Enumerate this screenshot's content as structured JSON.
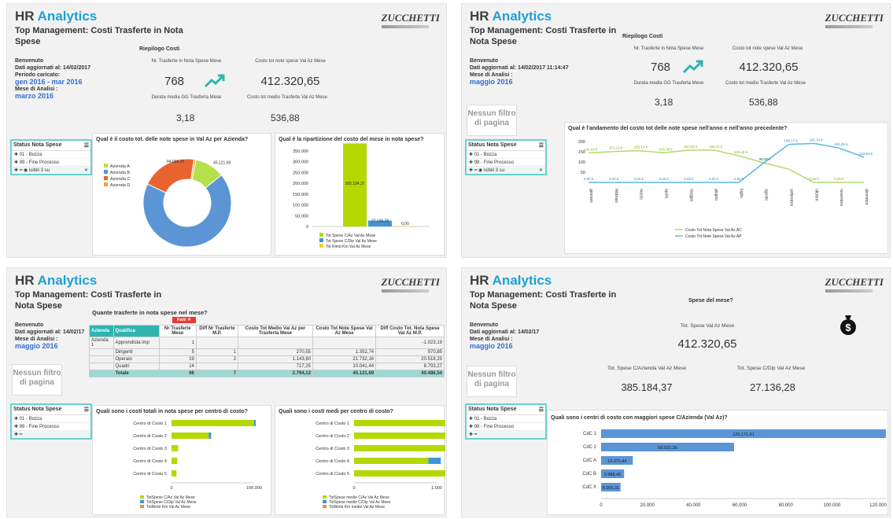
{
  "brand": {
    "hr": "HR",
    "analytics": "Analytics",
    "logo": "ZUCCHETTI"
  },
  "title": "Top Management: Costi Trasferte in Nota Spese",
  "status_nota_spese": {
    "title": "Status Nota Spese",
    "r1": "01 - Bozza",
    "r2": "99 - Fine Processo",
    "r3": "isibili 3 su"
  },
  "no_filter": "Nessun filtro di pagina",
  "p1": {
    "welcome": "Benvenuto",
    "updated": "Dati aggiornati al: 14/02/2017",
    "period_label": "Periodo caricato:",
    "period": "gen 2016 - mar 2016",
    "month_label": "Mese di Analisi :",
    "month": "marzo 2016",
    "riepilogo": "Riepilogo Costi",
    "k1l": "Nr. Trasferte in Nota Spese Mese",
    "k1v": "768",
    "k2l": "Costo tot note spese Val Az Mese",
    "k2v": "412.320,65",
    "k3l": "Durata media GG Trasferta Mese",
    "k3v": "3,18",
    "k4l": "Costo tot medio Trasferte Val Az Mese",
    "k4v": "536,88",
    "donut_title": "Qual è il costo tot. delle note spese in Val Az per Azienda?",
    "bar_title": "Qual è la ripartizione del costo del mese in nota spese?"
  },
  "p2": {
    "welcome": "Benvenuto",
    "updated": "Dati aggiornati al: 14/02/2017 11:14:47",
    "month_label": "Mese di Analisi :",
    "month": "maggio 2016",
    "riepilogo": "Riepilogo Costi",
    "k1l": "Nr. Trasferte in Nota Spese Mese",
    "k1v": "768",
    "k2l": "Costo tot note spese Val Az Mese",
    "k2v": "412.320,65",
    "k3l": "Durata media GG Trasferta Mese",
    "k3v": "3,18",
    "k4l": "Costo tot medio Trasferte Val Az Mese",
    "k4v": "536,88",
    "line_title": "Qual è l'andamento del costo tot delle note spese nell'anno e nell'anno precedente?"
  },
  "p3": {
    "welcome": "Benvenuto",
    "updated": "Dati aggiornati al: 14/02/17",
    "month_label": "Mese di Analisi :",
    "month": "maggio 2016",
    "table_title": "Quante trasferte in nota spese nel mese?",
    "filter_tag": "Fatti",
    "hbar1_title": "Quali sono i costi totali in nota spese per centro di costo?",
    "hbar2_title": "Quali sono i costi medi per centro di costo?"
  },
  "p4": {
    "welcome": "Benvenuto",
    "updated": "Dati aggiornati al: 14/02/17",
    "month_label": "Mese di Analisi :",
    "month": "maggio 2016",
    "spese_title": "Spese del mese?",
    "tot_label": "Tot. Spese Val Az Mese",
    "tot_value": "412.320,65",
    "az_label": "Tot. Spese C/Azienda Val Az Mese",
    "az_value": "385.184,37",
    "dip_label": "Tot. Spese C/Dip Val Az Mese",
    "dip_value": "27.136,28",
    "hbar_title": "Quali sono i centri di costo con maggiori spese C/Azienda (Val Az)?"
  },
  "table": {
    "headers": [
      "Azienda",
      "Qualifica",
      "Nr Trasferte Mese",
      "Diff Nr Trasferte M.P.",
      "Costo Tot Medio Val Az per Trasferta Mese",
      "Costo Tot Note Spese Val Az Mese",
      "Diff Costo Tot. Nota Spese Val Az M.P."
    ],
    "rows": [
      [
        "Azienda 1",
        "Apprendista imp",
        "1",
        "",
        "",
        "",
        "-1.023,19"
      ],
      [
        "",
        "Dirigenti",
        "5",
        "1",
        "270,55",
        "1.352,74",
        "970,85"
      ],
      [
        "",
        "Operaio",
        "19",
        "2",
        "1.143,80",
        "21.732,16",
        "20.518,25"
      ],
      [
        "",
        "Quadri",
        "14",
        "",
        "717,25",
        "10.041,44",
        "8.793,27"
      ],
      [
        "",
        "Totale",
        "66",
        "7",
        "2.794,12",
        "45.121,69",
        "40.486,54"
      ]
    ]
  },
  "chart_data": [
    {
      "type": "pie",
      "title": "Qual è il costo tot. delle note spese in Val Az per Azienda?",
      "categories": [
        "Azienda A",
        "Azienda B",
        "Azienda C",
        "Azienda D"
      ],
      "values": [
        45121.69,
        280000,
        84090.25,
        3000
      ],
      "data_labels": [
        "45.121,69",
        "",
        "84.090,25",
        ""
      ],
      "colors": [
        "#b5e04b",
        "#5b95d6",
        "#e8642f",
        "#f5a623"
      ]
    },
    {
      "type": "bar",
      "title": "Qual è la ripartizione del costo del mese in nota spese?",
      "categories": [
        "Tot Spese C/Az Val Az Mese",
        "Tot Spese C/Dip Val Az Mese",
        "Tot Rimb Km Val Az Mese"
      ],
      "values": [
        385184.37,
        27136.28,
        0
      ],
      "data_labels": [
        "385.184,37",
        "27.136,28",
        "0,00"
      ],
      "ylim": [
        0,
        350000
      ],
      "yticks": [
        "0",
        "50.000",
        "100.000",
        "150.000",
        "200.000",
        "250.000",
        "300.000",
        "350.000"
      ],
      "colors": [
        "#b5d800",
        "#3d97d8",
        "#f5d328"
      ]
    },
    {
      "type": "line",
      "title": "Qual è l'andamento del costo tot delle note spese nell'anno e nell'anno precedente?",
      "categories": [
        "gennaio",
        "febbraio",
        "marzo",
        "aprile",
        "maggio",
        "giugno",
        "luglio",
        "agosto",
        "settembre",
        "ottobre",
        "novembre",
        "dicembre"
      ],
      "ylim": [
        0,
        200
      ],
      "yticks": [
        "50",
        "100",
        "150",
        "200"
      ],
      "series": [
        {
          "name": "Costo Tot Nota Spese Val Az AC",
          "color": "#b5d86a",
          "values": [
            144.53,
            151.13,
            155.14,
            145.06,
            157.82,
            158.41,
            130.46,
            95.66,
            65.2,
            0,
            0,
            0
          ],
          "data_labels": [
            "144,53 k",
            "151,13 k",
            "155,14 k",
            "145,06 k",
            "157,82 k",
            "158,41 k",
            "130,46 k",
            "95,66 k",
            "",
            "0,00 k",
            "0,00 k",
            ""
          ]
        },
        {
          "name": "Costo Tot Note Spese Val Az AP",
          "color": "#5fb6e0",
          "values": [
            0,
            0,
            0,
            0,
            0,
            0,
            0,
            95.66,
            186.17,
            190.74,
            169.05,
            123.53
          ],
          "data_labels": [
            "0,00 k",
            "0,00 k",
            "0,00 k",
            "0,00 k",
            "0,00 k",
            "0,00 k",
            "0,00 k",
            "78,73 k",
            "186,17 k",
            "190,74 k",
            "169,05 k",
            "123,53 k"
          ]
        }
      ]
    },
    {
      "type": "bar",
      "orientation": "horizontal",
      "title": "Quali sono i costi totali in nota spese per centro di costo?",
      "categories": [
        "Centro di Costo 1",
        "Centro di Costo 2",
        "Centro di Costo 3",
        "Centro di Costo 4",
        "Centro di Costo 5"
      ],
      "xlim": [
        0,
        100000
      ],
      "xticks": [
        "0",
        "100.000"
      ],
      "series": [
        {
          "name": "TotSpese C/Az Val Az Mese",
          "values": [
            100000,
            45000,
            8000,
            7000,
            6000
          ]
        },
        {
          "name": "TotSpese C/Dip Val Az Mese",
          "values": [
            2000,
            3000,
            0,
            0,
            0
          ]
        },
        {
          "name": "TotRimb Km Val Az Mese",
          "values": [
            0,
            0,
            0,
            0,
            0
          ]
        }
      ],
      "colors": [
        "#b5d800",
        "#3d97d8",
        "#f58a2a"
      ]
    },
    {
      "type": "bar",
      "orientation": "horizontal",
      "title": "Quali sono i costi medi per centro di costo?",
      "categories": [
        "Centro di Costo 1",
        "Centro di Costo 2",
        "Centro di Costo 3",
        "Centro di Costo 4",
        "Centro di Costo 5"
      ],
      "xlim": [
        0,
        1000
      ],
      "xticks": [
        "0",
        "1.000"
      ],
      "series": [
        {
          "name": "TotSpese medie C/Az Val Az Mese",
          "values": [
            1400,
            1450,
            1350,
            900,
            1250
          ]
        },
        {
          "name": "TotSpese medie C/Dip Val Az Mese",
          "values": [
            50,
            50,
            80,
            150,
            60
          ]
        },
        {
          "name": "TotRimb Km medie Val Az Mese",
          "values": [
            0,
            0,
            0,
            0,
            0
          ]
        }
      ],
      "colors": [
        "#b5d800",
        "#3d97d8",
        "#f58a2a"
      ]
    },
    {
      "type": "bar",
      "orientation": "horizontal",
      "title": "Quali sono i centri di costo con maggiori spese C/Azienda (Val Az)?",
      "categories": [
        "CdC 1",
        "CdC 2",
        "CdC A",
        "CdC B",
        "CdC X"
      ],
      "values": [
        125171.91,
        56022.3,
        13370.44,
        9688.4,
        8205.31
      ],
      "data_labels": [
        "125.171,91",
        "56.022,30",
        "13.370,44",
        "9.688,40",
        "8.205,31"
      ],
      "xlim": [
        0,
        120000
      ],
      "xticks": [
        "0",
        "20.000",
        "40.000",
        "60.000",
        "80.000",
        "100.000",
        "120.000"
      ],
      "colors": [
        "#5b95d6"
      ]
    }
  ]
}
